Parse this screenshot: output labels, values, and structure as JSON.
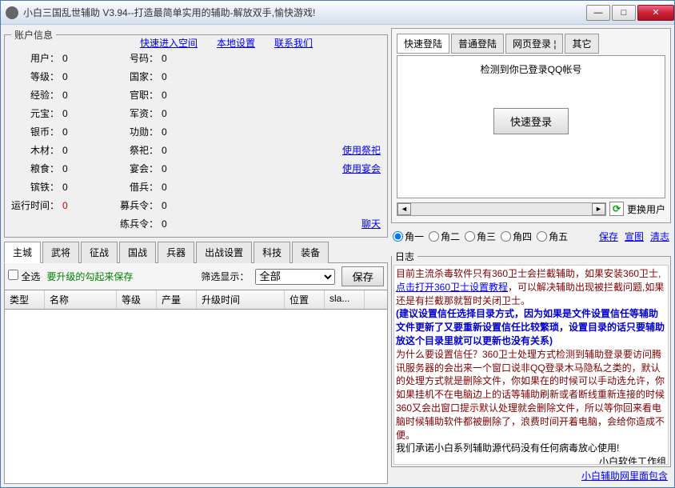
{
  "window": {
    "title": "小白三国乱世辅助 V3.94--打造最简单实用的辅助-解放双手,愉快游戏!"
  },
  "account": {
    "legend": "账户信息",
    "links": {
      "quickspace": "快速进入空间",
      "localSettings": "本地设置",
      "contact": "联系我们"
    },
    "left": [
      {
        "lbl": "用户：",
        "val": "0"
      },
      {
        "lbl": "等级：",
        "val": "0"
      },
      {
        "lbl": "经验：",
        "val": "0"
      },
      {
        "lbl": "元宝：",
        "val": "0"
      },
      {
        "lbl": "银币：",
        "val": "0"
      },
      {
        "lbl": "木材：",
        "val": "0"
      },
      {
        "lbl": "粮食：",
        "val": "0"
      },
      {
        "lbl": "镔铁：",
        "val": "0"
      },
      {
        "lbl": "运行时间：",
        "val": "0",
        "red": true
      }
    ],
    "right": [
      {
        "lbl": "号码：",
        "val": "0"
      },
      {
        "lbl": "国家：",
        "val": "0"
      },
      {
        "lbl": "官职：",
        "val": "0"
      },
      {
        "lbl": "军资：",
        "val": "0"
      },
      {
        "lbl": "功勋：",
        "val": "0"
      },
      {
        "lbl": "祭祀：",
        "val": "0",
        "link": "使用祭祀"
      },
      {
        "lbl": "宴会：",
        "val": "0",
        "link": "使用宴会"
      },
      {
        "lbl": "借兵：",
        "val": "0"
      },
      {
        "lbl": "募兵令：",
        "val": "0"
      },
      {
        "lbl": "练兵令：",
        "val": "0",
        "link": "聊天"
      }
    ]
  },
  "mainTabs": [
    "主城",
    "武将",
    "征战",
    "国战",
    "兵器",
    "出战设置",
    "科技",
    "装备"
  ],
  "filterRow": {
    "selectAll": "全选",
    "hint": "要升级的勾起来保存",
    "filterLabel": "筛选显示：",
    "filterValue": "全部",
    "saveBtn": "保存"
  },
  "tableHeaders": [
    "类型",
    "名称",
    "等级",
    "产量",
    "升级时间",
    "位置",
    "sla..."
  ],
  "login": {
    "tabs": [
      "快速登陆",
      "普通登陆",
      "网页登录",
      "其它"
    ],
    "detectText": "检测到你已登录QQ帐号",
    "quickBtn": "快速登录",
    "switchUser": "更换用户"
  },
  "corners": {
    "items": [
      "角一",
      "角二",
      "角三",
      "角四",
      "角五"
    ],
    "links": [
      "保存",
      "宣图",
      "清志"
    ]
  },
  "log": {
    "legend": "日志",
    "l1a": "目前主流杀毒软件只有360卫士会拦截辅助，如果安装360卫士,",
    "l1b": "点击打开360卫士设置教程",
    "l1c": "，可以解决辅助出现被拦截问题,如果还是有拦截那就暂时关闭卫士。",
    "l2": "(建议设置信任选择目录方式，因为如果是文件设置信任等辅助文件更新了又要重新设置信任比较繁琐，设置目录的话只要辅助放这个目录里就可以更新也没有关系)",
    "l3": "为什么要设置信任？360卫士处理方式检测到辅助登录要访问腾讯服务器的会出来一个窗口说非QQ登录木马隐私之类的，默认的处理方式就是删除文件，你如果在的时候可以手动选允许，你如果挂机不在电脑边上的话等辅助刷新或者断线重新连接的时候360又会出窗口提示默认处理就会删除文件，所以等你回来看电脑时候辅助软件都被删除了，浪费时间开着电脑，会给你造成不便。",
    "l4": "我们承诺小白系列辅助源代码没有任何病毒放心使用!",
    "l5": "小白软件工作组",
    "bottomLink": "小白辅助网里面包含"
  }
}
